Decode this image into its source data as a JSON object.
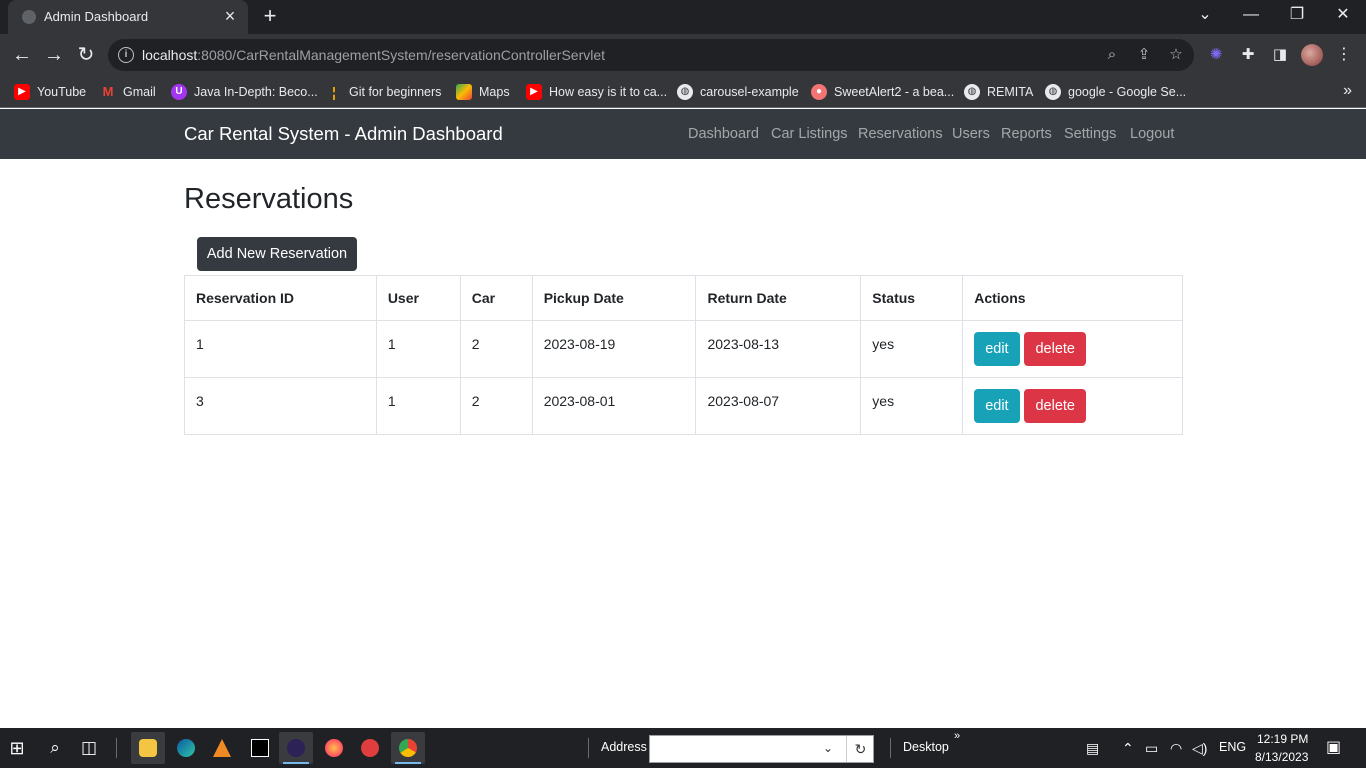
{
  "browser": {
    "tab_title": "Admin Dashboard",
    "url_host": "localhost",
    "url_rest": ":8080/CarRentalManagementSystem/reservationControllerServlet",
    "bookmarks": [
      {
        "label": "YouTube",
        "icon": "youtube-icon",
        "color": "#ff0000"
      },
      {
        "label": "Gmail",
        "icon": "gmail-icon",
        "color": "#ea4335"
      },
      {
        "label": "Java In-Depth: Beco...",
        "icon": "udemy-icon",
        "color": "#a435f0"
      },
      {
        "label": "Git for beginners",
        "icon": "bookmark-icon",
        "color": "#f9ab00"
      },
      {
        "label": "Maps",
        "icon": "maps-icon",
        "color": "#34a853"
      },
      {
        "label": "How easy is it to ca...",
        "icon": "youtube-icon",
        "color": "#ff0000"
      },
      {
        "label": "carousel-example",
        "icon": "globe-icon",
        "color": "#5f6368"
      },
      {
        "label": "SweetAlert2 - a bea...",
        "icon": "sweetalert-icon",
        "color": "#f27474"
      },
      {
        "label": "REMITA",
        "icon": "globe-icon",
        "color": "#5f6368"
      },
      {
        "label": "google - Google Se...",
        "icon": "globe-icon",
        "color": "#5f6368"
      }
    ]
  },
  "navbar": {
    "brand": "Car Rental System - Admin Dashboard",
    "links": [
      "Dashboard",
      "Car Listings",
      "Reservations",
      "Users",
      "Reports",
      "Settings",
      "Logout"
    ]
  },
  "main": {
    "title": "Reservations",
    "add_button": "Add New Reservation",
    "columns": [
      "Reservation ID",
      "User",
      "Car",
      "Pickup Date",
      "Return Date",
      "Status",
      "Actions"
    ],
    "rows": [
      {
        "id": "1",
        "user": "1",
        "car": "2",
        "pickup": "2023-08-19",
        "return": "2023-08-13",
        "status": "yes"
      },
      {
        "id": "3",
        "user": "1",
        "car": "2",
        "pickup": "2023-08-01",
        "return": "2023-08-07",
        "status": "yes"
      }
    ],
    "edit_label": "edit",
    "delete_label": "delete"
  },
  "taskbar": {
    "address_label": "Address",
    "desktop_label": "Desktop",
    "language": "ENG",
    "time": "12:19 PM",
    "date": "8/13/2023"
  },
  "colors": {
    "navbar_bg": "#343a40",
    "edit_btn": "#17a2b8",
    "delete_btn": "#dc3545"
  }
}
